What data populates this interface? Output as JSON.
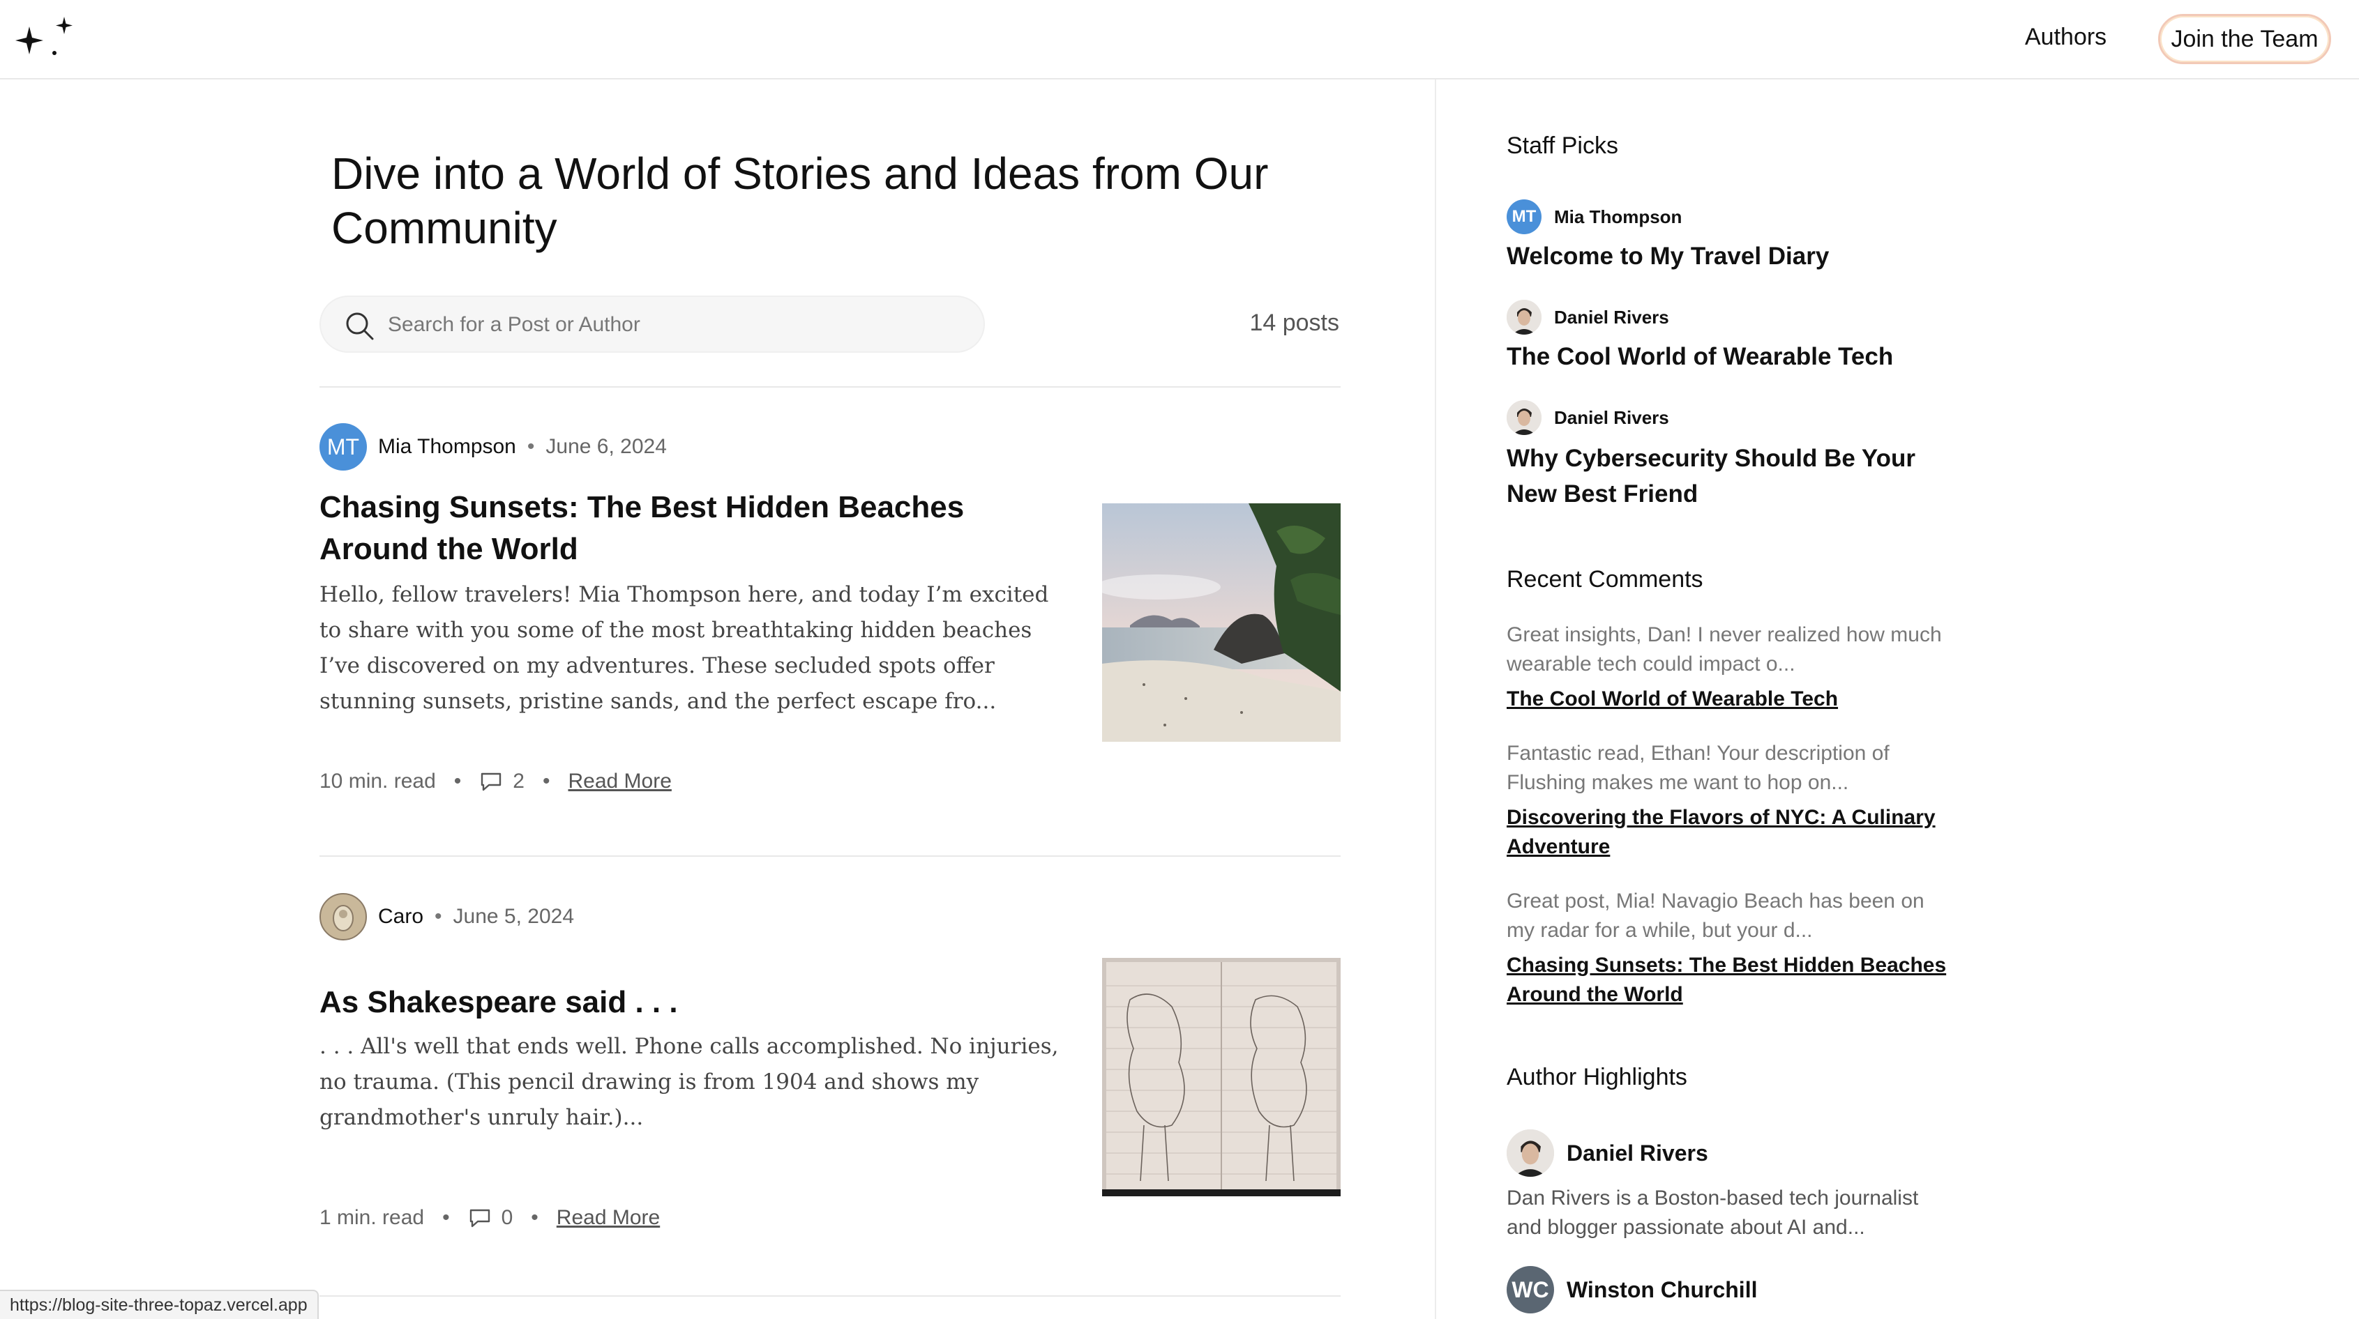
{
  "header": {
    "logo_icon": "sparkles-icon",
    "nav_authors": "Authors",
    "join_button": "Join the Team"
  },
  "main": {
    "hero_title": "Dive into a World of Stories and Ideas from Our Community",
    "search": {
      "placeholder": "Search for a Post or Author"
    },
    "post_count": "14 posts",
    "posts": [
      {
        "author": "Mia Thompson",
        "author_initials": "MT",
        "date": "June 6, 2024",
        "title": "Chasing Sunsets: The Best Hidden Beaches Around the World",
        "excerpt": "Hello, fellow travelers! Mia Thompson here, and today I’m excited to share with you some of the most breathtaking hidden beaches I’ve discovered on my adventures. These secluded spots offer stunning sunsets, pristine sands, and the perfect escape fro...",
        "read_time": "10 min. read",
        "comments": "2",
        "read_more": "Read More",
        "image": "beach-photo"
      },
      {
        "author": "Caro",
        "date": "June 5, 2024",
        "title": "As Shakespeare said . . .",
        "excerpt": ". . . All's well that ends well. Phone calls accomplished. No injuries, no trauma. (This pencil drawing is from 1904 and shows my grandmother's unruly hair.)...",
        "read_time": "1 min. read",
        "comments": "0",
        "read_more": "Read More",
        "image": "pencil-drawing-photo"
      }
    ]
  },
  "sidebar": {
    "staff_picks_heading": "Staff Picks",
    "staff_picks": [
      {
        "author": "Mia Thompson",
        "initials": "MT",
        "title": "Welcome to My Travel Diary"
      },
      {
        "author": "Daniel Rivers",
        "title": "The Cool World of Wearable Tech"
      },
      {
        "author": "Daniel Rivers",
        "title": "Why Cybersecurity Should Be Your New Best Friend"
      }
    ],
    "recent_comments_heading": "Recent Comments",
    "recent_comments": [
      {
        "text": "Great insights, Dan! I never realized how much wearable tech could impact o...",
        "post": "The Cool World of Wearable Tech"
      },
      {
        "text": "Fantastic read, Ethan! Your description of Flushing makes me want to hop on...",
        "post": "Discovering the Flavors of NYC: A Culinary Adventure"
      },
      {
        "text": "Great post, Mia! Navagio Beach has been on my radar for a while, but your d...",
        "post": "Chasing Sunsets: The Best Hidden Beaches Around the World"
      }
    ],
    "author_highlights_heading": "Author Highlights",
    "author_highlights": [
      {
        "name": "Daniel Rivers",
        "bio": "Dan Rivers is a Boston-based tech journalist and blogger passionate about AI and..."
      },
      {
        "name": "Winston Churchill",
        "initials": "WC"
      }
    ]
  },
  "status_bar": {
    "url": "https://blog-site-three-topaz.vercel.app"
  },
  "colors": {
    "accent_avatar": "#4a90d9",
    "join_border": "#f2c9b7",
    "divider": "#e8e8e8"
  }
}
